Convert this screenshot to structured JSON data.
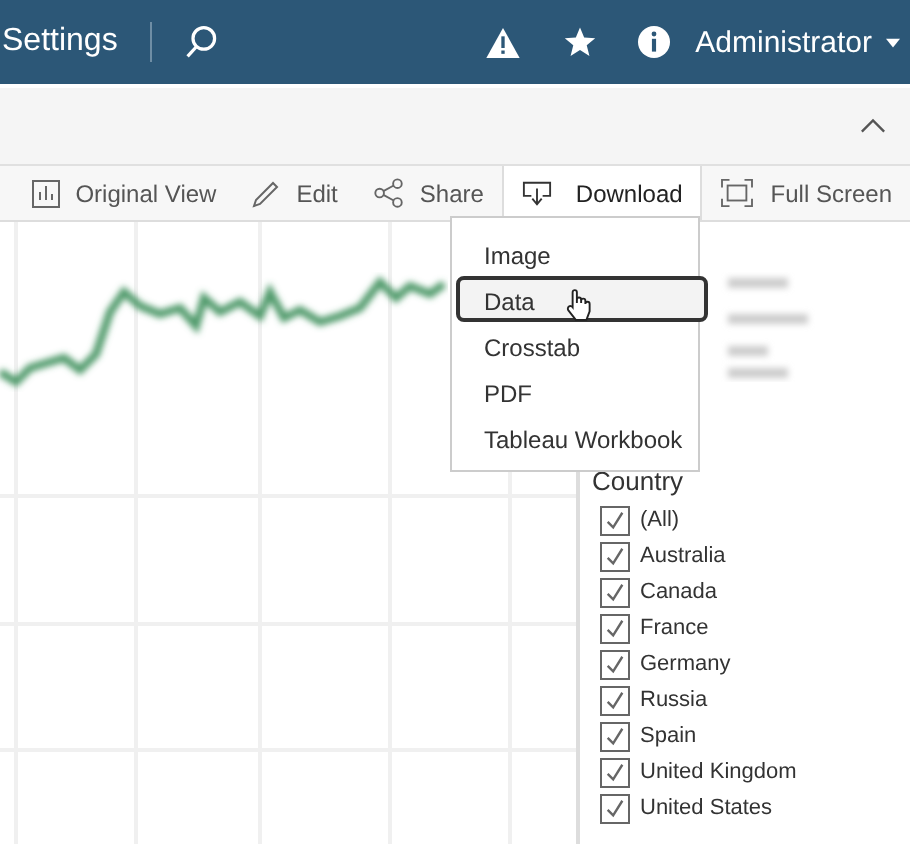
{
  "top_bar": {
    "section": "Settings",
    "user": "Administrator"
  },
  "toolbar": {
    "items": [
      {
        "kind": "original",
        "label": "Original View",
        "selected": false
      },
      {
        "kind": "edit",
        "label": "Edit",
        "selected": false
      },
      {
        "kind": "share",
        "label": "Share",
        "selected": false
      },
      {
        "kind": "download",
        "label": "Download",
        "selected": true
      },
      {
        "kind": "fullscreen",
        "label": "Full Screen",
        "selected": false
      }
    ]
  },
  "download_menu": {
    "items": [
      {
        "label": "Image",
        "selected": false
      },
      {
        "label": "Data",
        "selected": true
      },
      {
        "label": "Crosstab",
        "selected": false
      },
      {
        "label": "PDF",
        "selected": false
      },
      {
        "label": "Tableau Workbook",
        "selected": false
      }
    ]
  },
  "filter": {
    "title": "Country",
    "options": [
      {
        "label": "(All)",
        "checked": true
      },
      {
        "label": "Australia",
        "checked": true
      },
      {
        "label": "Canada",
        "checked": true
      },
      {
        "label": "France",
        "checked": true
      },
      {
        "label": "Germany",
        "checked": true
      },
      {
        "label": "Russia",
        "checked": true
      },
      {
        "label": "Spain",
        "checked": true
      },
      {
        "label": "United Kingdom",
        "checked": true
      },
      {
        "label": "United States",
        "checked": true
      }
    ]
  }
}
